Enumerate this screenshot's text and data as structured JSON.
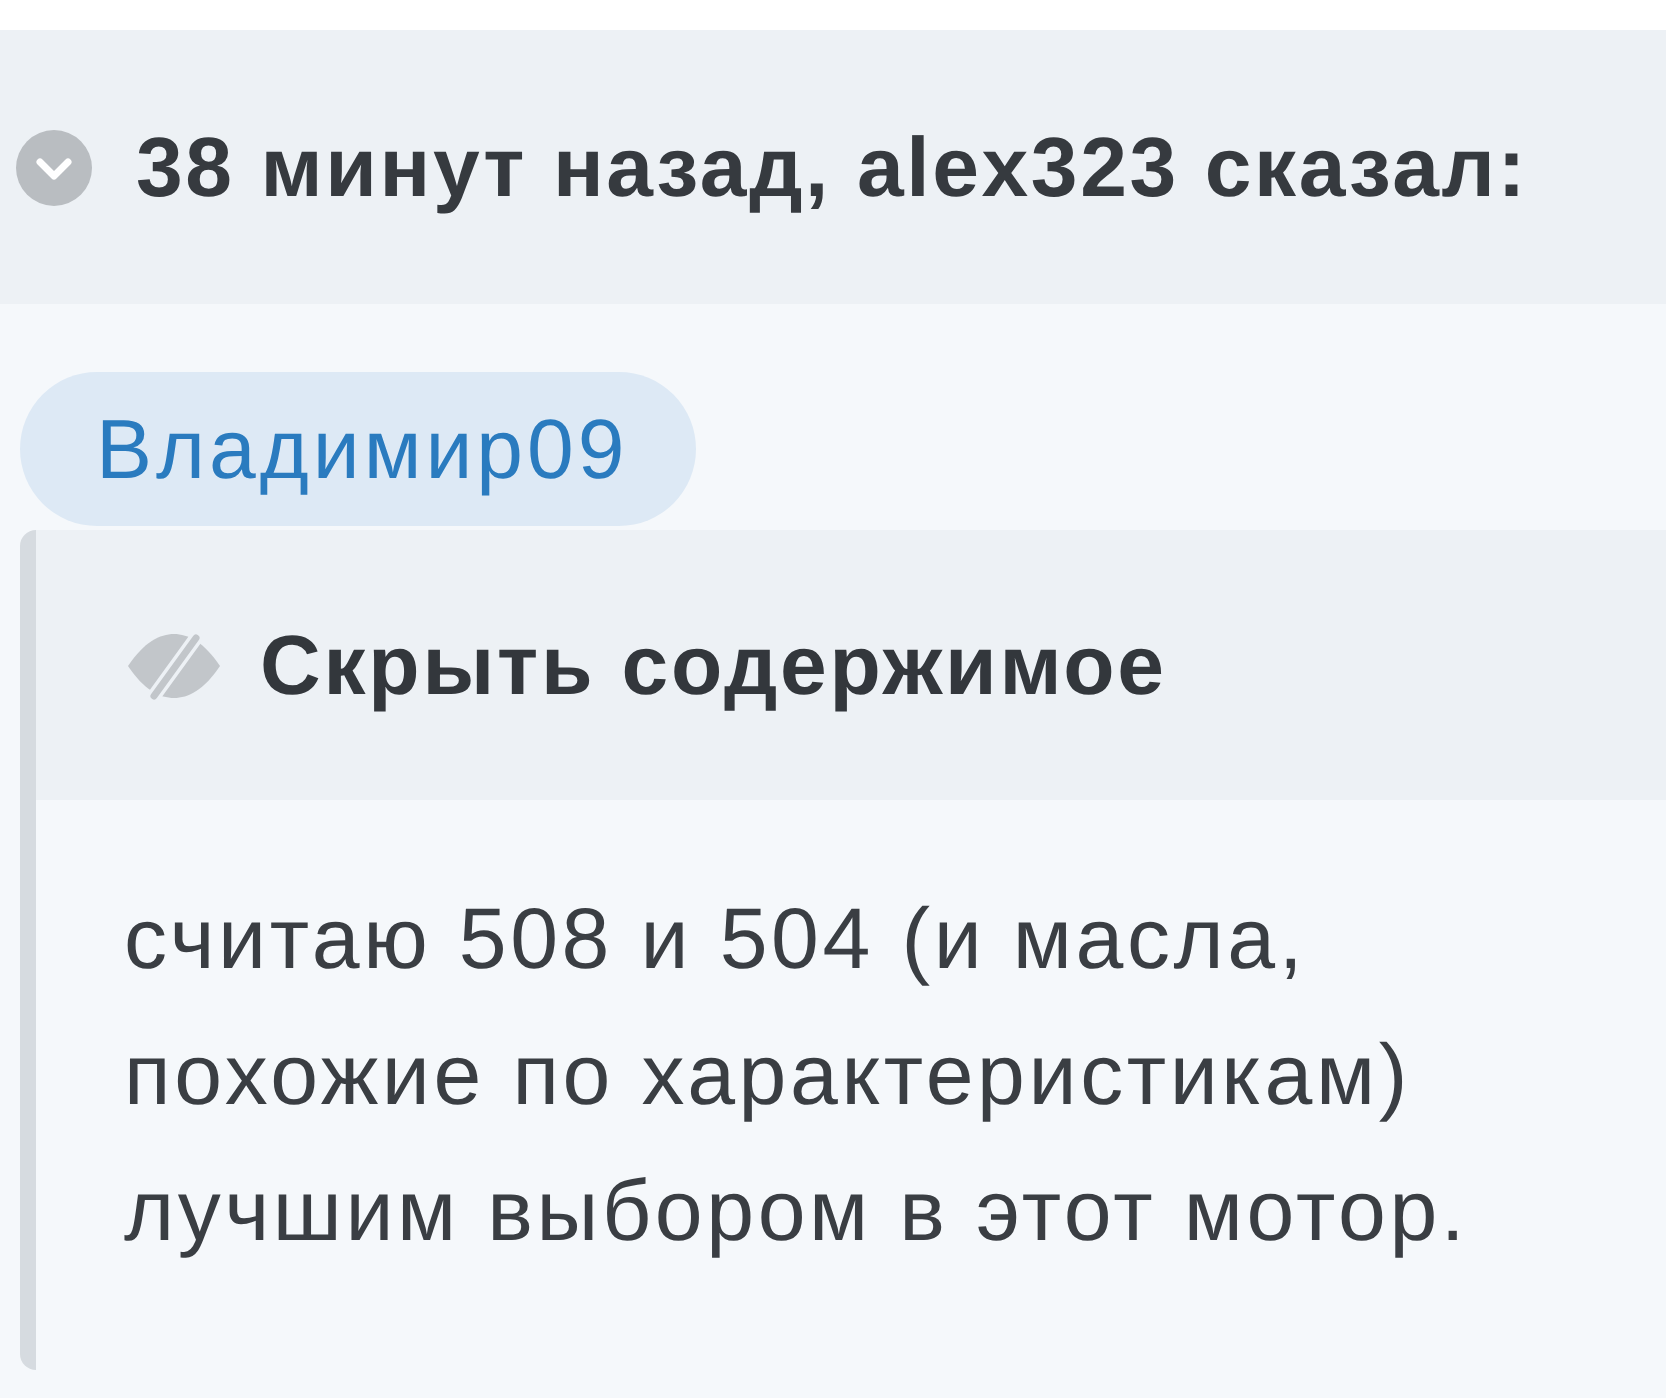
{
  "quote": {
    "author_line": "38 минут назад, alex323 сказал:",
    "mention": "Владимир09",
    "spoiler": {
      "open": true,
      "title": "Скрыть содержимое",
      "text": "считаю 508 и 504 (и масла, похожие по характеристикам) лучшим выбором в этот мотор."
    }
  }
}
